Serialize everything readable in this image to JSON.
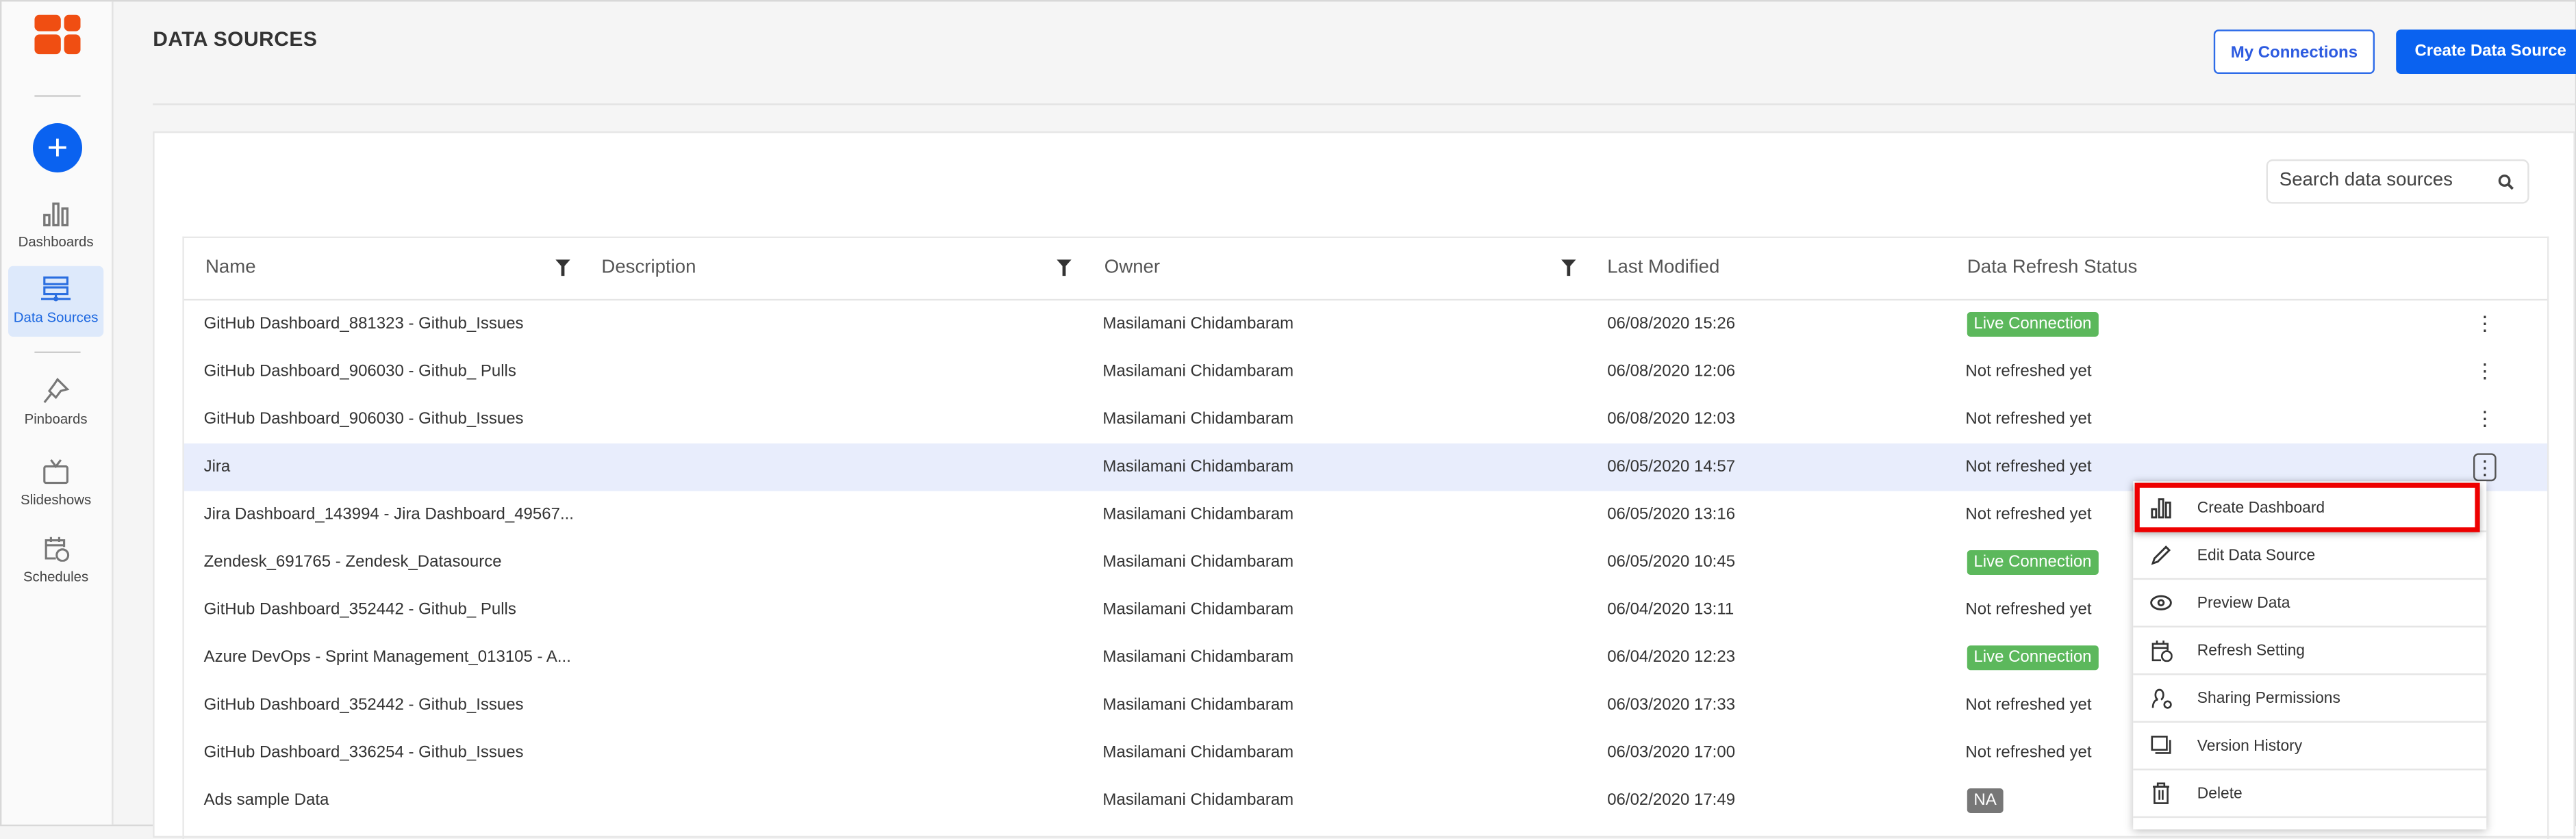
{
  "colors": {
    "accent": "#0a62f0",
    "live": "#5cb85c",
    "na": "#777777",
    "highlight": "#e8edfc",
    "callout": "#ee0000"
  },
  "sidebar": {
    "create_icon": "plus-icon",
    "items": [
      {
        "label": "Dashboards",
        "icon": "bar-chart-icon",
        "active": false
      },
      {
        "label": "Data Sources",
        "icon": "database-icon",
        "active": true
      },
      {
        "label": "Pinboards",
        "icon": "pin-icon",
        "active": false
      },
      {
        "label": "Slideshows",
        "icon": "tv-icon",
        "active": false
      },
      {
        "label": "Schedules",
        "icon": "calendar-clock-icon",
        "active": false
      }
    ]
  },
  "header": {
    "title": "DATA SOURCES",
    "my_connections": "My Connections",
    "create_data_source": "Create Data Source"
  },
  "search": {
    "placeholder": "Search data sources",
    "value": ""
  },
  "table": {
    "columns": [
      "Name",
      "Description",
      "Owner",
      "Last Modified",
      "Data Refresh Status"
    ],
    "rows": [
      {
        "name": "GitHub Dashboard_881323 - Github_Issues",
        "description": "",
        "owner": "Masilamani Chidambaram",
        "modified": "06/08/2020 15:26",
        "status": "Live Connection",
        "status_type": "live"
      },
      {
        "name": "GitHub Dashboard_906030 - Github_ Pulls",
        "description": "",
        "owner": "Masilamani Chidambaram",
        "modified": "06/08/2020 12:06",
        "status": "Not refreshed yet",
        "status_type": "text"
      },
      {
        "name": "GitHub Dashboard_906030 - Github_Issues",
        "description": "",
        "owner": "Masilamani Chidambaram",
        "modified": "06/08/2020 12:03",
        "status": "Not refreshed yet",
        "status_type": "text"
      },
      {
        "name": "Jira",
        "description": "",
        "owner": "Masilamani Chidambaram",
        "modified": "06/05/2020 14:57",
        "status": "Not refreshed yet",
        "status_type": "text",
        "selected": true
      },
      {
        "name": "Jira Dashboard_143994 - Jira Dashboard_49567...",
        "description": "",
        "owner": "Masilamani Chidambaram",
        "modified": "06/05/2020 13:16",
        "status": "Not refreshed yet",
        "status_type": "text"
      },
      {
        "name": "Zendesk_691765 - Zendesk_Datasource",
        "description": "",
        "owner": "Masilamani Chidambaram",
        "modified": "06/05/2020 10:45",
        "status": "Live Connection",
        "status_type": "live"
      },
      {
        "name": "GitHub Dashboard_352442 - Github_ Pulls",
        "description": "",
        "owner": "Masilamani Chidambaram",
        "modified": "06/04/2020 13:11",
        "status": "Not refreshed yet",
        "status_type": "text"
      },
      {
        "name": "Azure DevOps - Sprint Management_013105 - A...",
        "description": "",
        "owner": "Masilamani Chidambaram",
        "modified": "06/04/2020 12:23",
        "status": "Live Connection",
        "status_type": "live"
      },
      {
        "name": "GitHub Dashboard_352442 - Github_Issues",
        "description": "",
        "owner": "Masilamani Chidambaram",
        "modified": "06/03/2020 17:33",
        "status": "Not refreshed yet",
        "status_type": "text"
      },
      {
        "name": "GitHub Dashboard_336254 - Github_Issues",
        "description": "",
        "owner": "Masilamani Chidambaram",
        "modified": "06/03/2020 17:00",
        "status": "Not refreshed yet",
        "status_type": "text"
      },
      {
        "name": "Ads sample Data",
        "description": "",
        "owner": "Masilamani Chidambaram",
        "modified": "06/02/2020 17:49",
        "status": "NA",
        "status_type": "na"
      }
    ]
  },
  "context_menu": {
    "items": [
      {
        "label": "Create Dashboard",
        "icon": "bar-chart-icon",
        "highlighted": true
      },
      {
        "label": "Edit Data Source",
        "icon": "pencil-icon"
      },
      {
        "label": "Preview Data",
        "icon": "eye-icon"
      },
      {
        "label": "Refresh Setting",
        "icon": "calendar-clock-icon"
      },
      {
        "label": "Sharing Permissions",
        "icon": "user-gear-icon"
      },
      {
        "label": "Version History",
        "icon": "stacked-pages-icon"
      },
      {
        "label": "Delete",
        "icon": "trash-icon"
      }
    ]
  }
}
